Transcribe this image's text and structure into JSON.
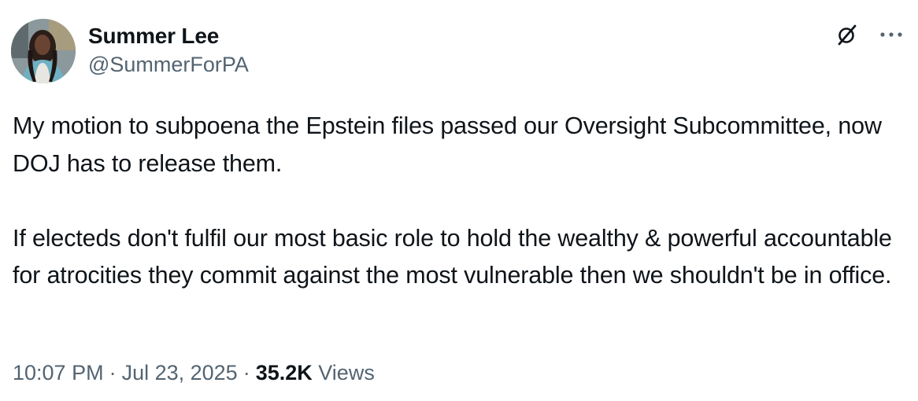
{
  "tweet": {
    "author": {
      "display_name": "Summer Lee",
      "handle": "@SummerForPA"
    },
    "paragraphs": [
      "My motion to subpoena the Epstein files passed our Oversight Subcommittee, now DOJ has to release them.",
      "If electeds don't fulfil our most basic role to hold the wealthy & powerful accountable for atrocities they commit against the most vulnerable then we shouldn't be in office."
    ],
    "meta": {
      "time": "10:07 PM",
      "separator": "·",
      "date": "Jul 23, 2025",
      "views_count": "35.2K",
      "views_label": "Views"
    },
    "icons": {
      "grok": "grok-icon",
      "more": "more-icon"
    }
  },
  "colors": {
    "text_primary": "#0f1419",
    "text_secondary": "#536471",
    "background": "#ffffff"
  }
}
